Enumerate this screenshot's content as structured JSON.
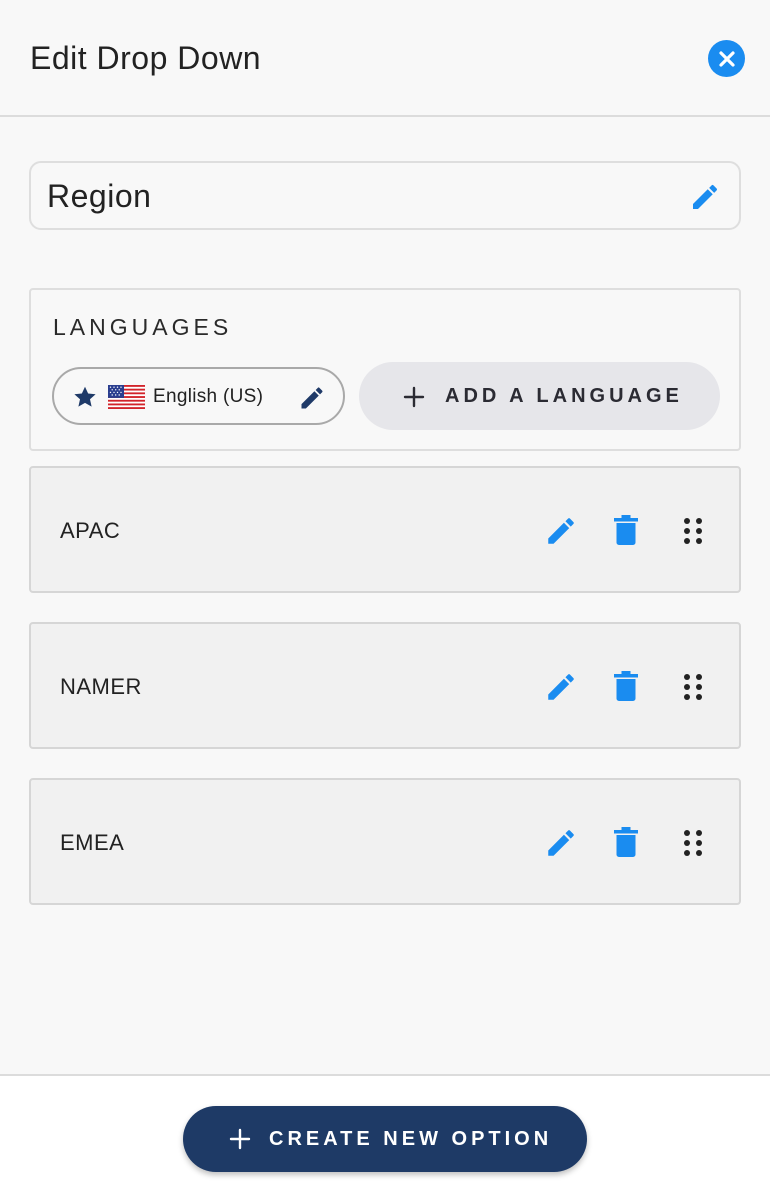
{
  "header": {
    "title": "Edit Drop Down",
    "close_icon": "close-circle-icon"
  },
  "name_field": {
    "value": "Region",
    "edit_icon": "pencil-icon"
  },
  "languages": {
    "title": "LANGUAGES",
    "chip": {
      "label": "English (US)",
      "default_icon": "star-icon",
      "flag_icon": "us-flag-icon",
      "edit_icon": "pencil-icon"
    },
    "add_button": {
      "label": "ADD A LANGUAGE",
      "icon": "plus-icon"
    }
  },
  "options": [
    {
      "label": "APAC"
    },
    {
      "label": "NAMER"
    },
    {
      "label": "EMEA"
    }
  ],
  "option_actions": {
    "edit_icon": "pencil-icon",
    "delete_icon": "trash-icon",
    "drag_icon": "drag-handle-icon"
  },
  "footer": {
    "create_button": {
      "label": "CREATE NEW OPTION",
      "icon": "plus-icon"
    }
  },
  "colors": {
    "accent_blue": "#1a8cf0",
    "navy": "#1e3a66",
    "chip_icon_navy": "#1f3a68"
  }
}
